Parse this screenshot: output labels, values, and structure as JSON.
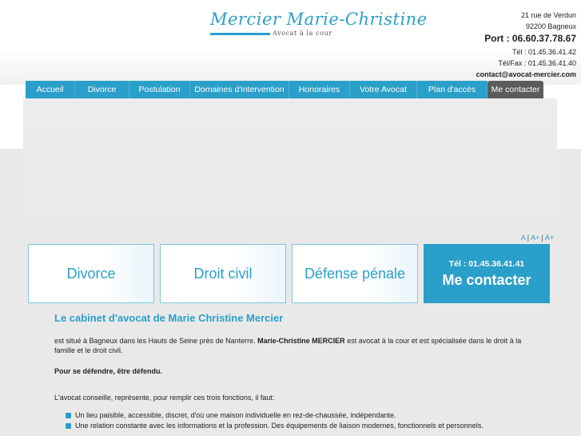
{
  "header": {
    "logo_name": "Mercier Marie-Christine",
    "logo_subtitle": "Avocat à la cour",
    "address_line1": "21 rue de Verdun",
    "address_line2": "92200 Bagneux",
    "port": "Port : 06.60.37.78.67",
    "tel": "Tél : 01.45.36.41.42",
    "telfax": "Tél/Fax : 01.45.36.41.40",
    "email": "contact@avocat-mercier.com"
  },
  "nav": {
    "items": [
      {
        "label": "Accueil"
      },
      {
        "label": "Divorce"
      },
      {
        "label": "Postulation"
      },
      {
        "label": "Domaines d'intervention"
      },
      {
        "label": "Honoraires"
      },
      {
        "label": "Votre Avocat"
      },
      {
        "label": "Plan d'accès"
      },
      {
        "label": "Me contacter"
      }
    ]
  },
  "font_size_control": {
    "a_small": "A",
    "a_medium": "A+",
    "a_large": "A+",
    "separator": "|"
  },
  "tiles": {
    "divorce": "Divorce",
    "droit_civil": "Droit civil",
    "defense_penale": "Défense pénale",
    "contact_tel": "Tél : 01.45.36.41.41",
    "contact_label": "Me contacter"
  },
  "content": {
    "title": "Le cabinet d'avocat de Marie Christine Mercier",
    "p1_start": "est situé à Bagneux dans les Hauts de Seine près de Nanterre. ",
    "p1_bold": "Marie-Christine MERCIER",
    "p1_end": " est avocat à la cour et est spécialisée dans le droit à la famille et le droit civil.",
    "p2": "Pour se défendre, être défendu.",
    "p3": "L'avocat conseille, représente, pour remplir ces trois fonctions, il faut:",
    "bullets": [
      "Un lieu paisible, accessible, discret, d'où une maison individuelle en rez-de-chaussée, indépendante.",
      "Une relation constante avec les informations et la profession. Des équipements de liaison modernes, fonctionnels et personnels."
    ]
  },
  "colors": {
    "accent": "#2a9fc9",
    "nav_active": "#5b5b5b",
    "background": "#e9e9e9"
  }
}
